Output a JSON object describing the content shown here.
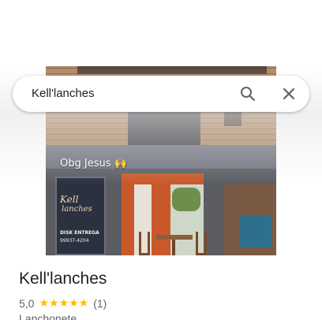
{
  "search": {
    "query": "Kell'lanches",
    "search_icon": "search-icon",
    "close_icon": "close-icon"
  },
  "photo": {
    "overlay_caption": "Obg Jesus 🙌",
    "sign_name_line1": "Kell",
    "sign_name_line2": "lanches",
    "sign_disk": "DISK ENTREGA",
    "sign_phone": "99937-4204"
  },
  "place": {
    "name": "Kell'lanches",
    "rating": "5,0",
    "stars": "★★★★★",
    "review_count": "(1)",
    "category": "Lanchonete"
  },
  "colors": {
    "star": "#fbbc04",
    "text_primary": "#202124",
    "text_secondary": "#5f6368"
  }
}
